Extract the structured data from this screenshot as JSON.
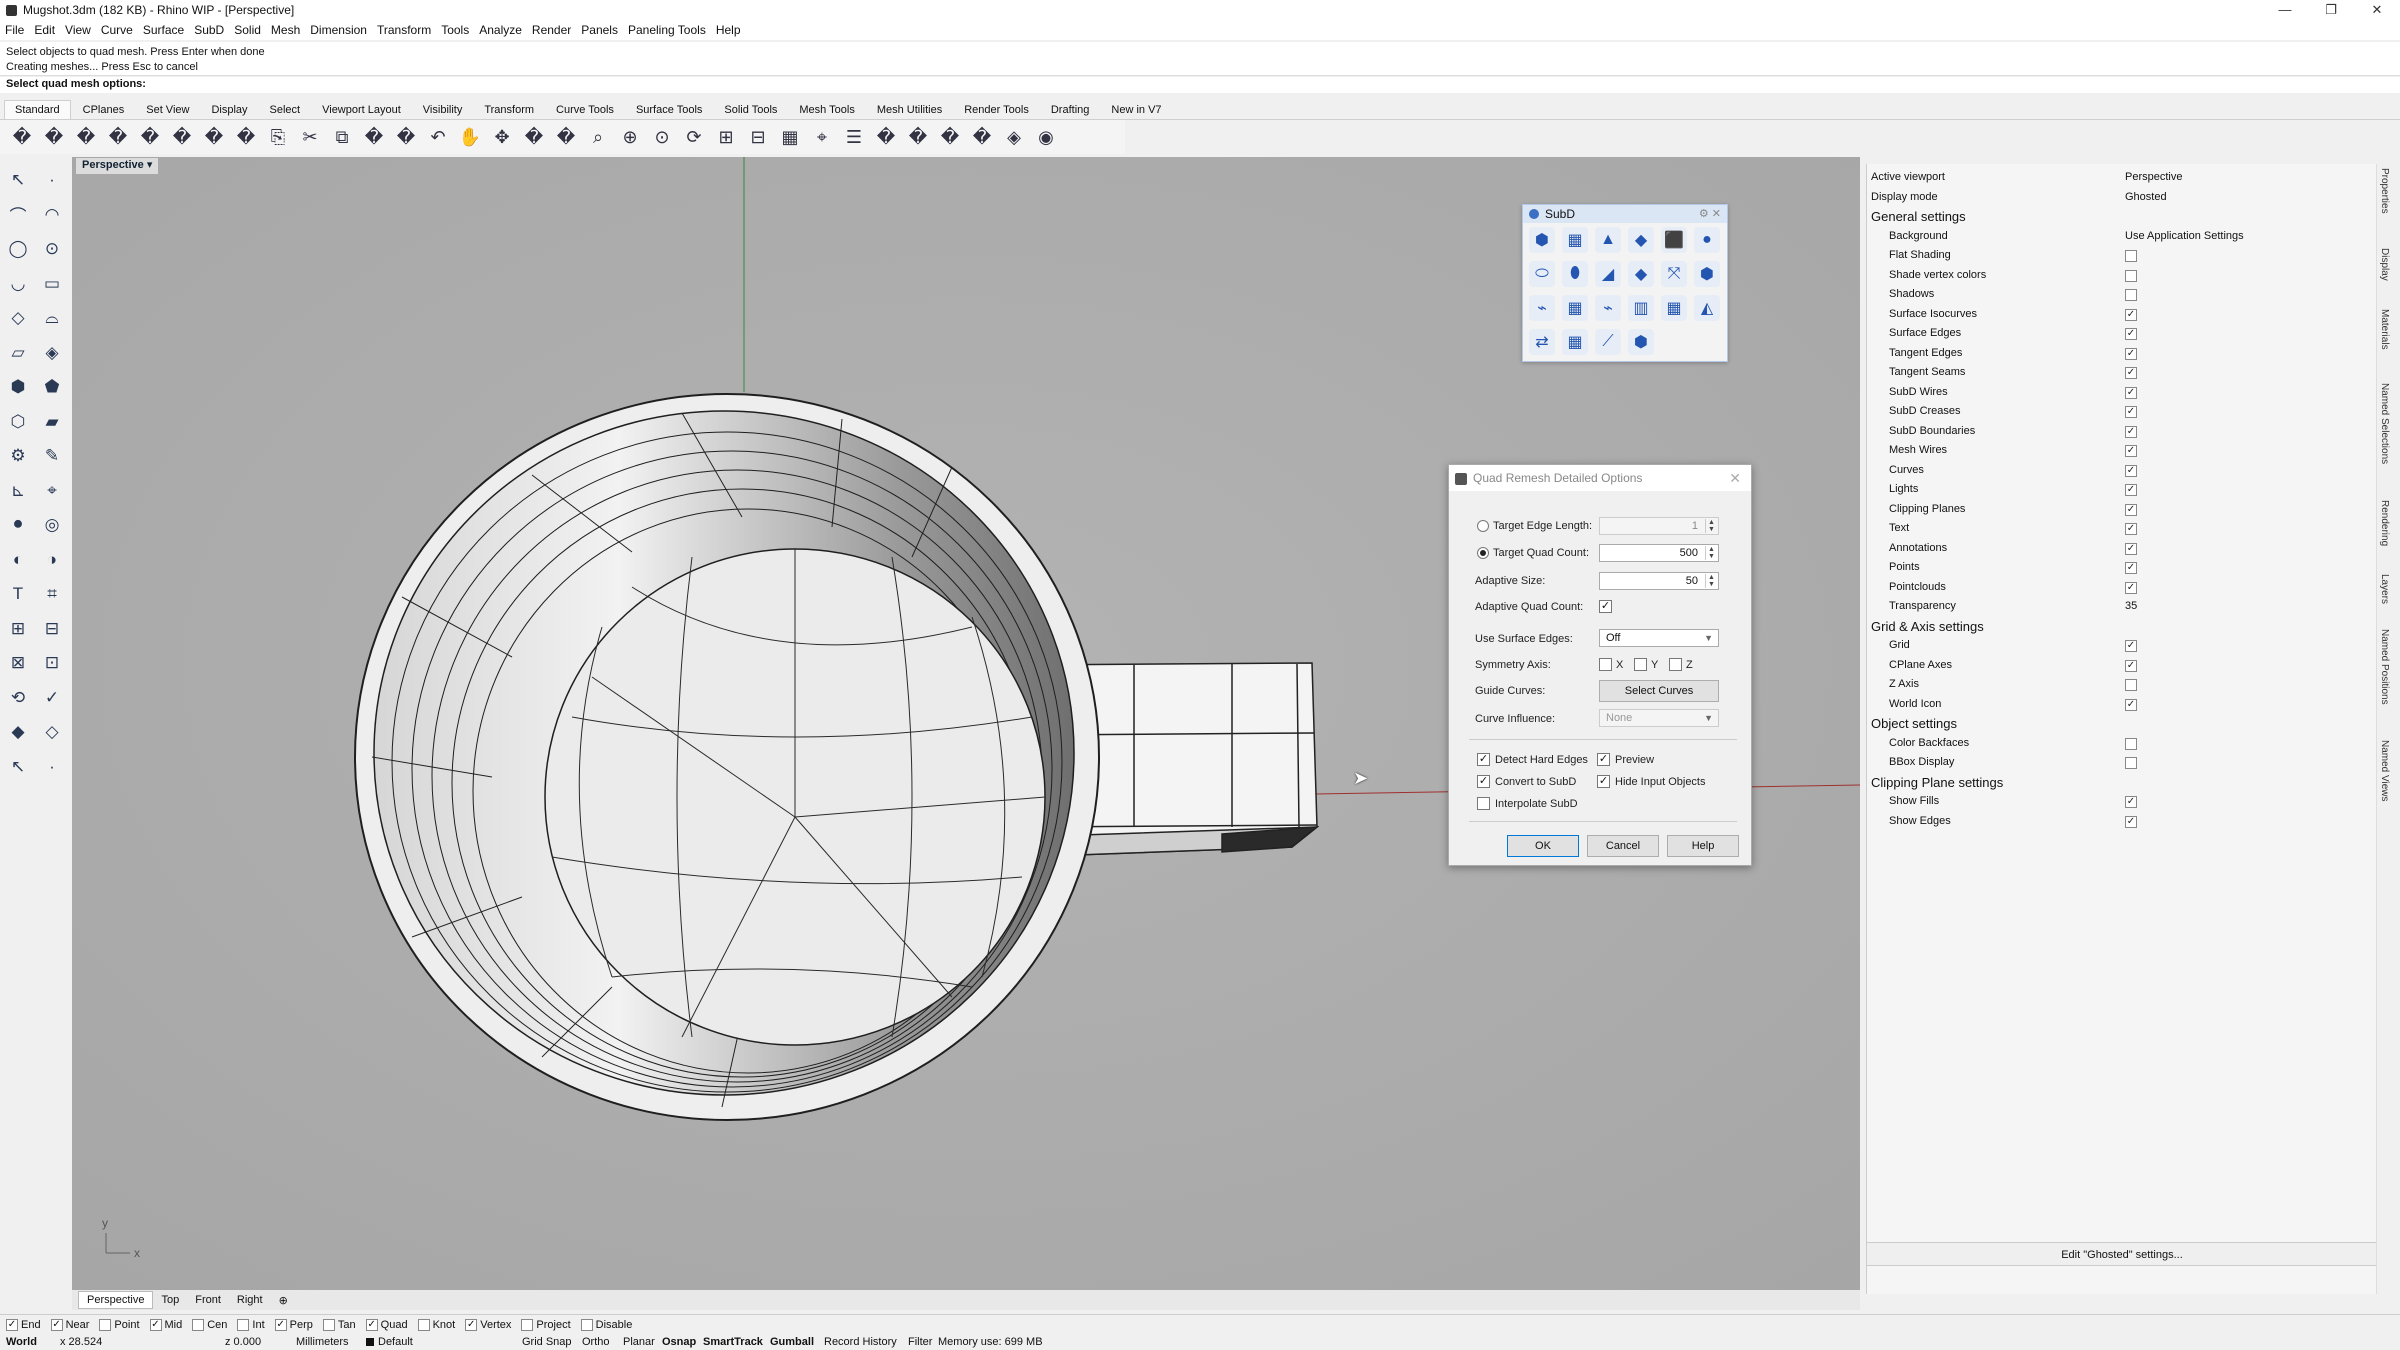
{
  "window": {
    "title": "Mugshot.3dm (182 KB) - Rhino WIP - [Perspective]",
    "controls": [
      "—",
      "❐",
      "✕"
    ]
  },
  "menu": [
    "File",
    "Edit",
    "View",
    "Curve",
    "Surface",
    "SubD",
    "Solid",
    "Mesh",
    "Dimension",
    "Transform",
    "Tools",
    "Analyze",
    "Render",
    "Panels",
    "Paneling Tools",
    "Help"
  ],
  "command": {
    "history": [
      "Select objects to quad mesh. Press Enter when done",
      "Creating meshes... Press Esc to cancel"
    ],
    "prompt": "Select quad mesh options:"
  },
  "tabs": [
    "Standard",
    "CPlanes",
    "Set View",
    "Display",
    "Select",
    "Viewport Layout",
    "Visibility",
    "Transform",
    "Curve Tools",
    "Surface Tools",
    "Solid Tools",
    "Mesh Tools",
    "Mesh Utilities",
    "Render Tools",
    "Drafting",
    "New in V7"
  ],
  "toolbar_icons": [
    "new-icon",
    "open-icon",
    "save-icon",
    "print-icon",
    "import-icon",
    "cut-icon",
    "copy-icon",
    "paste-icon",
    "undo-icon",
    "pan-icon",
    "move-icon",
    "zoom-icon",
    "zoom-window-icon",
    "zoom-extents-icon",
    "zoom-selected-icon",
    "rotate-view-icon",
    "four-views-icon",
    "cplane-icon",
    "grid-icon",
    "osnap-icon",
    "layer-icon",
    "lights-icon",
    "lock-icon",
    "material-icon",
    "color-wheel-icon",
    "render-icon",
    "raytrace-icon",
    "sphere-icon",
    "filter-icon",
    "options-icon",
    "gumball-icon",
    "globe-icon",
    "help-icon"
  ],
  "viewport": {
    "label": "Perspective",
    "tabs": [
      "Perspective",
      "Top",
      "Front",
      "Right"
    ],
    "axis_x": "x",
    "axis_y": "y"
  },
  "subd_panel": {
    "title": "SubD"
  },
  "dialog": {
    "title": "Quad Remesh Detailed Options",
    "target_edge_length": {
      "label": "Target Edge Length:",
      "value": "1"
    },
    "target_quad_count": {
      "label": "Target Quad Count:",
      "value": "500"
    },
    "adaptive_size": {
      "label": "Adaptive Size:",
      "value": "50"
    },
    "adaptive_quad_count": {
      "label": "Adaptive Quad Count:"
    },
    "use_surface_edges": {
      "label": "Use Surface Edges:",
      "value": "Off"
    },
    "symmetry_axis": {
      "label": "Symmetry Axis:",
      "x": "X",
      "y": "Y",
      "z": "Z"
    },
    "guide_curves": {
      "label": "Guide Curves:",
      "button": "Select Curves"
    },
    "curve_influence": {
      "label": "Curve Influence:",
      "value": "None"
    },
    "detect_hard_edges": "Detect Hard Edges",
    "preview": "Preview",
    "convert_to_subd": "Convert to SubD",
    "hide_input_objects": "Hide Input Objects",
    "interpolate_subd": "Interpolate SubD",
    "ok": "OK",
    "cancel": "Cancel",
    "help": "Help"
  },
  "properties": {
    "active_viewport": {
      "k": "Active viewport",
      "v": "Perspective"
    },
    "display_mode": {
      "k": "Display mode",
      "v": "Ghosted"
    },
    "general": "General settings",
    "background": {
      "k": "Background",
      "v": "Use Application Settings"
    },
    "general_items": [
      {
        "k": "Flat Shading",
        "c": false
      },
      {
        "k": "Shade vertex colors",
        "c": false
      },
      {
        "k": "Shadows",
        "c": false
      },
      {
        "k": "Surface Isocurves",
        "c": true
      },
      {
        "k": "Surface Edges",
        "c": true
      },
      {
        "k": "Tangent Edges",
        "c": true
      },
      {
        "k": "Tangent Seams",
        "c": true
      },
      {
        "k": "SubD Wires",
        "c": true
      },
      {
        "k": "SubD Creases",
        "c": true
      },
      {
        "k": "SubD Boundaries",
        "c": true
      },
      {
        "k": "Mesh Wires",
        "c": true
      },
      {
        "k": "Curves",
        "c": true
      },
      {
        "k": "Lights",
        "c": true
      },
      {
        "k": "Clipping Planes",
        "c": true
      },
      {
        "k": "Text",
        "c": true
      },
      {
        "k": "Annotations",
        "c": true
      },
      {
        "k": "Points",
        "c": true
      },
      {
        "k": "Pointclouds",
        "c": true
      }
    ],
    "transparency": {
      "k": "Transparency",
      "v": "35"
    },
    "grid_axis": "Grid & Axis settings",
    "grid_items": [
      {
        "k": "Grid",
        "c": true
      },
      {
        "k": "CPlane Axes",
        "c": true
      },
      {
        "k": "Z Axis",
        "c": false
      },
      {
        "k": "World Icon",
        "c": true
      }
    ],
    "object": "Object settings",
    "object_items": [
      {
        "k": "Color Backfaces",
        "c": false
      },
      {
        "k": "BBox Display",
        "c": false
      }
    ],
    "clipping": "Clipping Plane settings",
    "clipping_items": [
      {
        "k": "Show Fills",
        "c": true
      },
      {
        "k": "Show Edges",
        "c": true
      }
    ],
    "edit_button": "Edit \"Ghosted\" settings..."
  },
  "side_tabs": [
    "Properties",
    "Display",
    "Materials",
    "Named Selections",
    "Rendering",
    "Layers",
    "Named Positions",
    "Named Views"
  ],
  "osnaps": [
    {
      "k": "End",
      "c": true
    },
    {
      "k": "Near",
      "c": true
    },
    {
      "k": "Point",
      "c": false
    },
    {
      "k": "Mid",
      "c": true
    },
    {
      "k": "Cen",
      "c": false
    },
    {
      "k": "Int",
      "c": false
    },
    {
      "k": "Perp",
      "c": true
    },
    {
      "k": "Tan",
      "c": false
    },
    {
      "k": "Quad",
      "c": true
    },
    {
      "k": "Knot",
      "c": false
    },
    {
      "k": "Vertex",
      "c": true
    },
    {
      "k": "Project",
      "c": false
    },
    {
      "k": "Disable",
      "c": false
    }
  ],
  "status": {
    "cplane": "World",
    "x": "x 28.524",
    "z": "z 0.000",
    "units": "Millimeters",
    "layer": "Default",
    "grid_snap": "Grid Snap",
    "ortho": "Ortho",
    "planar": "Planar",
    "osnap": "Osnap",
    "smarttrack": "SmartTrack",
    "gumball": "Gumball",
    "record_history": "Record History",
    "filter": "Filter",
    "memory": "Memory use: 699 MB"
  }
}
